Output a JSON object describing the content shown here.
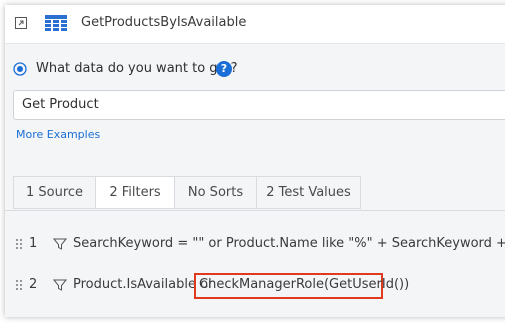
{
  "header": {
    "title": "GetProductsByIsAvailable",
    "expand_icon": "expand-icon",
    "entity_icon": "table-icon"
  },
  "question": {
    "label": "What data do you want to get?",
    "help": "?"
  },
  "query": {
    "value": "Get Product",
    "more_examples": "More Examples"
  },
  "tabs": [
    {
      "label": "1 Source"
    },
    {
      "label": "2 Filters",
      "active": true
    },
    {
      "label": "No Sorts"
    },
    {
      "label": "2 Test Values"
    }
  ],
  "filters": [
    {
      "num": "1",
      "expr": "SearchKeyword = \"\" or Product.Name like \"%\" + SearchKeyword + \"%\""
    },
    {
      "num": "2",
      "expr": "Product.IsAvailable or ",
      "highlight": "CheckManagerRole(GetUserId())"
    }
  ],
  "colors": {
    "accent": "#1b6ed6",
    "highlight_border": "#e03a1e"
  }
}
